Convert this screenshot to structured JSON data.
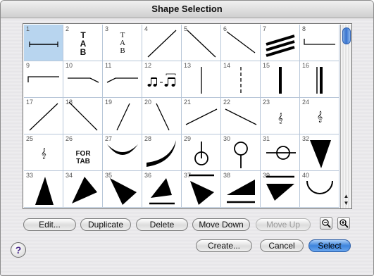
{
  "window": {
    "title": "Shape Selection"
  },
  "shapes": [
    {
      "n": "1"
    },
    {
      "n": "2"
    },
    {
      "n": "3"
    },
    {
      "n": "4"
    },
    {
      "n": "5"
    },
    {
      "n": "6"
    },
    {
      "n": "7"
    },
    {
      "n": "8"
    },
    {
      "n": "9"
    },
    {
      "n": "10"
    },
    {
      "n": "11"
    },
    {
      "n": "12"
    },
    {
      "n": "13"
    },
    {
      "n": "14"
    },
    {
      "n": "15"
    },
    {
      "n": "16"
    },
    {
      "n": "17"
    },
    {
      "n": "18"
    },
    {
      "n": "19"
    },
    {
      "n": "20"
    },
    {
      "n": "21"
    },
    {
      "n": "22"
    },
    {
      "n": "23"
    },
    {
      "n": "24"
    },
    {
      "n": "25"
    },
    {
      "n": "26"
    },
    {
      "n": "27"
    },
    {
      "n": "28"
    },
    {
      "n": "29"
    },
    {
      "n": "30"
    },
    {
      "n": "31"
    },
    {
      "n": "32"
    },
    {
      "n": "33"
    },
    {
      "n": "34"
    },
    {
      "n": "35"
    },
    {
      "n": "36"
    },
    {
      "n": "37"
    },
    {
      "n": "38"
    },
    {
      "n": "39"
    },
    {
      "n": "40"
    }
  ],
  "glyphs": {
    "tab_bold_t": "T",
    "tab_bold_a": "A",
    "tab_bold_b": "B",
    "tab_serif_t": "T",
    "tab_serif_a": "A",
    "tab_serif_b": "B",
    "treble": "𝄞",
    "for_tab_1": "FOR",
    "for_tab_2": "TAB"
  },
  "buttons": {
    "edit": "Edit...",
    "duplicate": "Duplicate",
    "delete": "Delete",
    "move_down": "Move Down",
    "move_up": "Move Up",
    "create": "Create...",
    "cancel": "Cancel",
    "select": "Select"
  },
  "help": "?",
  "scroll_arrows": {
    "up": "▲",
    "down": "▼"
  },
  "selected_shape": "1",
  "colors": {
    "selection": "#b8d5ef",
    "default_button": "#3d84dc",
    "grid_line": "#b7c6d8"
  }
}
